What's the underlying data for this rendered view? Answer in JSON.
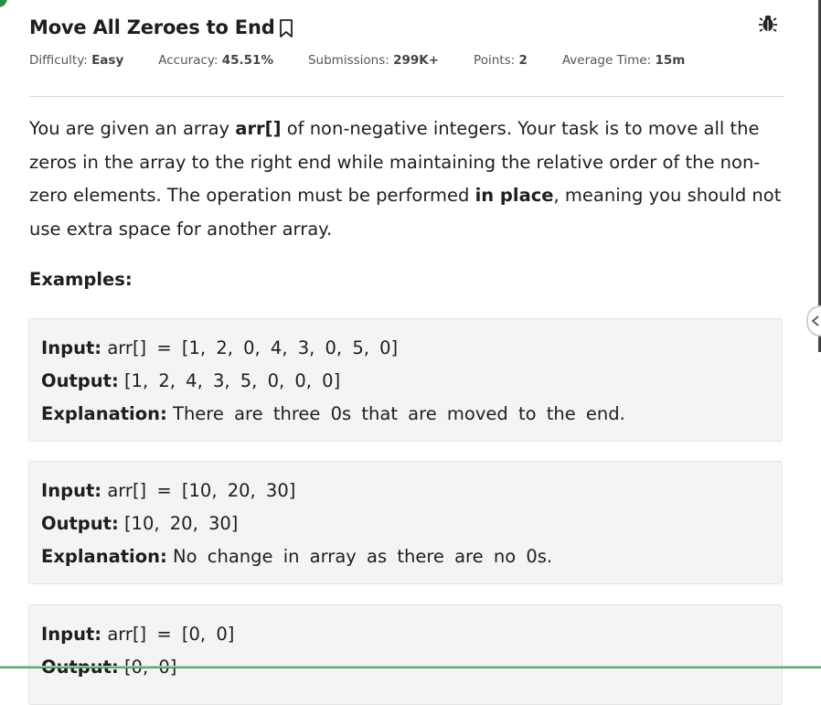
{
  "problem": {
    "title": "Move All Zeroes to End",
    "meta": [
      {
        "label": "Difficulty:",
        "value": "Easy"
      },
      {
        "label": "Accuracy:",
        "value": "45.51%"
      },
      {
        "label": "Submissions:",
        "value": "299K+"
      },
      {
        "label": "Points:",
        "value": "2"
      },
      {
        "label": "Average Time:",
        "value": "15m"
      }
    ],
    "description": {
      "p1": "You are given an array ",
      "b1": "arr[]",
      "p2": " of non-negative integers. Your task is to move all the zeros in the array to the right end while maintaining the relative order of the non-zero elements. The operation must be performed ",
      "b2": "in place",
      "p3": ", meaning you should not use extra space for another array."
    },
    "examples_heading": "Examples:",
    "examples": [
      {
        "input_label": "Input:",
        "input": "arr[] = [1, 2, 0, 4, 3, 0, 5, 0]",
        "output_label": "Output:",
        "output": "[1, 2, 4, 3, 5, 0, 0, 0]",
        "explanation_label": "Explanation:",
        "explanation": "There are three 0s that are moved to the end."
      },
      {
        "input_label": "Input:",
        "input": "arr[] = [10, 20, 30]",
        "output_label": "Output:",
        "output": "[10, 20, 30]",
        "explanation_label": "Explanation:",
        "explanation": "No change in array as there are no 0s."
      },
      {
        "input_label": "Input:",
        "input": "arr[] = [0, 0]",
        "output_label": "Output:",
        "output": "[0, 0]"
      }
    ]
  },
  "icons": {
    "bookmark": "bookmark-icon",
    "bug": "bug-icon",
    "side_toggle": "chevron-left-icon"
  },
  "colors": {
    "accent": "#2f8d46",
    "example_bg": "#f4f4f4"
  }
}
